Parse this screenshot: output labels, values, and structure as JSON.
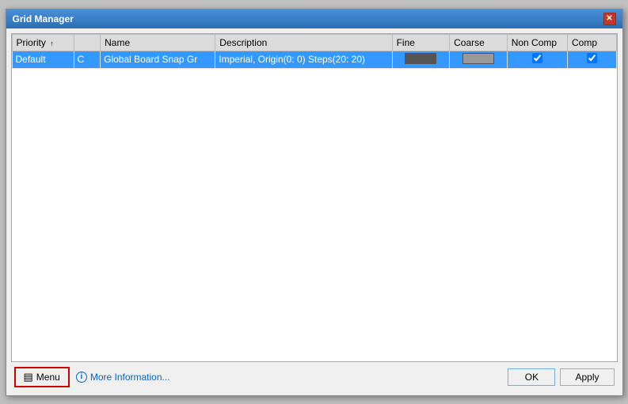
{
  "window": {
    "title": "Grid Manager"
  },
  "table": {
    "columns": [
      {
        "key": "priority",
        "label": "Priority",
        "sortable": true,
        "sort_arrow": "↑"
      },
      {
        "key": "type",
        "label": "",
        "sortable": false
      },
      {
        "key": "name",
        "label": "Name",
        "sortable": false
      },
      {
        "key": "description",
        "label": "Description",
        "sortable": false
      },
      {
        "key": "fine",
        "label": "Fine",
        "sortable": false
      },
      {
        "key": "coarse",
        "label": "Coarse",
        "sortable": false
      },
      {
        "key": "noncomp",
        "label": "Non Comp",
        "sortable": false
      },
      {
        "key": "comp",
        "label": "Comp",
        "sortable": false
      }
    ],
    "rows": [
      {
        "priority": "Default",
        "type": "C",
        "name": "Global Board Snap Gr",
        "description": "Imperial, Origin(0: 0) Steps(20: 20)",
        "fine_color": "#555555",
        "coarse_color": "#999999",
        "noncomp_checked": true,
        "comp_checked": true,
        "selected": true
      }
    ]
  },
  "buttons": {
    "menu": "Menu",
    "more_info": "More Information...",
    "ok": "OK",
    "apply": "Apply"
  },
  "icons": {
    "close": "✕",
    "menu_icon": "▤",
    "info": "i",
    "check": "✓"
  }
}
